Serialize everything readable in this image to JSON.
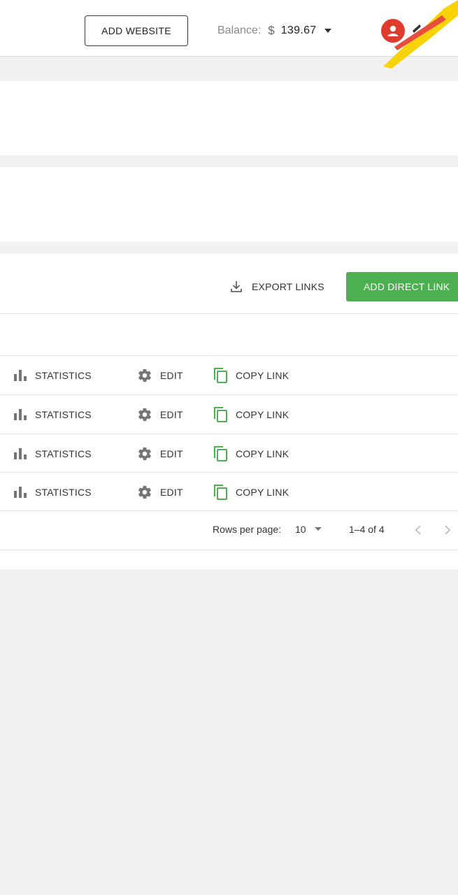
{
  "header": {
    "add_website_label": "ADD WEBSITE",
    "balance_label": "Balance:",
    "balance_currency": "$",
    "balance_amount": "139.67"
  },
  "toolbar": {
    "export_label": "EXPORT LINKS",
    "add_direct_label": "ADD DIRECT LINK"
  },
  "rows": [
    {
      "statistics_label": "STATISTICS",
      "edit_label": "EDIT",
      "copy_label": "COPY LINK"
    },
    {
      "statistics_label": "STATISTICS",
      "edit_label": "EDIT",
      "copy_label": "COPY LINK"
    },
    {
      "statistics_label": "STATISTICS",
      "edit_label": "EDIT",
      "copy_label": "COPY LINK"
    },
    {
      "statistics_label": "STATISTICS",
      "edit_label": "EDIT",
      "copy_label": "COPY LINK"
    }
  ],
  "pagination": {
    "rows_per_page_label": "Rows per page:",
    "rows_per_page_value": "10",
    "range_label": "1–4 of 4"
  },
  "icons": {
    "statistics": "bar-chart-icon",
    "edit": "gear-icon",
    "copy": "copy-icon",
    "export": "download-icon",
    "avatar": "user-icon"
  },
  "colors": {
    "accent_green": "#4caf50",
    "avatar_red": "#e03b2f",
    "icon_gray": "#757575"
  }
}
